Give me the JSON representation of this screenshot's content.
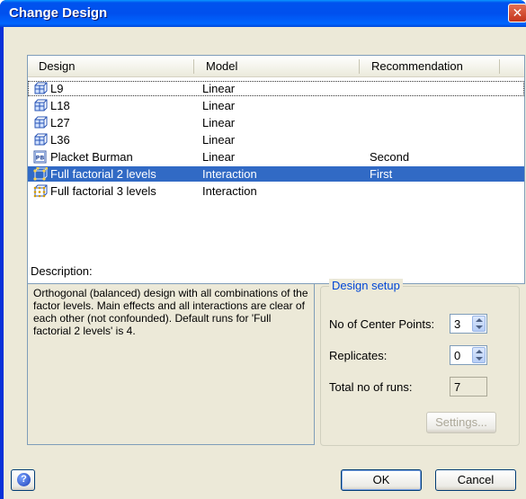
{
  "window": {
    "title": "Change Design",
    "close_glyph": "✕"
  },
  "list": {
    "columns": [
      "Design",
      "Model",
      "Recommendation"
    ],
    "rows": [
      {
        "icon": "grid-cube-icon",
        "design": "L9",
        "model": "Linear",
        "recommendation": ""
      },
      {
        "icon": "grid-cube-icon",
        "design": "L18",
        "model": "Linear",
        "recommendation": ""
      },
      {
        "icon": "grid-cube-icon",
        "design": "L27",
        "model": "Linear",
        "recommendation": ""
      },
      {
        "icon": "grid-cube-icon",
        "design": "L36",
        "model": "Linear",
        "recommendation": ""
      },
      {
        "icon": "pb-badge-icon",
        "design": "Placket Burman",
        "model": "Linear",
        "recommendation": "Second"
      },
      {
        "icon": "factorial-2-icon",
        "design": "Full factorial 2 levels",
        "model": "Interaction",
        "recommendation": "First",
        "selected": true
      },
      {
        "icon": "factorial-3-icon",
        "design": "Full factorial 3 levels",
        "model": "Interaction",
        "recommendation": ""
      }
    ],
    "selected_color": "#316ac5"
  },
  "description": {
    "label": "Description:",
    "text": "Orthogonal (balanced) design with all combinations of the factor levels. Main effects and all interactions are clear of each other (not confounded). Default runs for 'Full factorial 2 levels' is 4."
  },
  "design_setup": {
    "legend": "Design setup",
    "center_points_label": "No of Center Points:",
    "center_points_value": "3",
    "replicates_label": "Replicates:",
    "replicates_value": "0",
    "total_runs_label": "Total no of runs:",
    "total_runs_value": "7",
    "settings_button": "Settings..."
  },
  "footer": {
    "help_glyph": "?",
    "ok": "OK",
    "cancel": "Cancel"
  }
}
